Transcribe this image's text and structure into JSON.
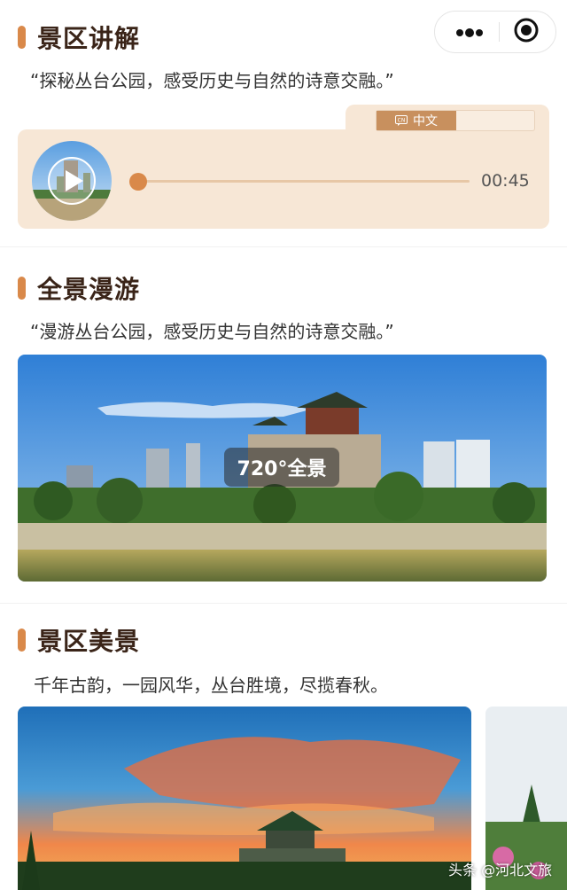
{
  "capsule": {
    "more_icon": "more-dots-icon",
    "close_icon": "target-circle-icon"
  },
  "audio": {
    "title": "景区讲解",
    "quote": "“探秘丛台公园，感受历史与自然的诗意交融。”",
    "language": "中文",
    "time": "00:45",
    "progress": 0.0
  },
  "panorama": {
    "title": "全景漫游",
    "quote": "“漫游丛台公园，感受历史与自然的诗意交融。”",
    "badge": "720°全景"
  },
  "scenery": {
    "title": "景区美景",
    "caption": "千年古韵，一园风华，丛台胜境，尽揽春秋。"
  },
  "watermark": "头条 @河北文旅",
  "colors": {
    "accent": "#d9894a",
    "card": "#f7e7d6",
    "title": "#3a2418"
  }
}
